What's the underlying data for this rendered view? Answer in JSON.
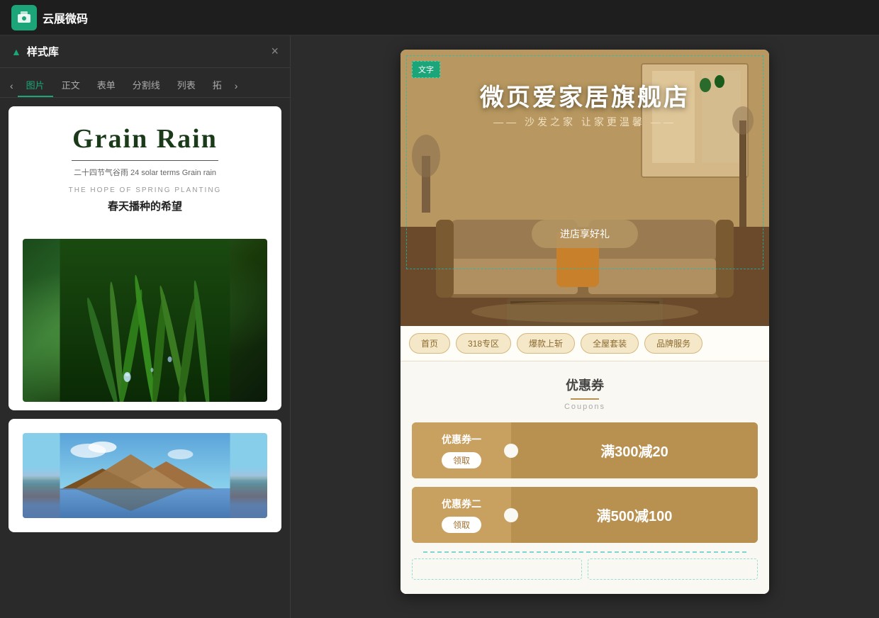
{
  "app": {
    "name": "云展微码",
    "logo_icon": "🖥"
  },
  "panel": {
    "title": "样式库",
    "close_label": "×",
    "tabs": [
      {
        "label": "图片",
        "active": true
      },
      {
        "label": "正文"
      },
      {
        "label": "表单"
      },
      {
        "label": "分割线"
      },
      {
        "label": "列表"
      },
      {
        "label": "拓"
      }
    ],
    "nav_prev": "‹",
    "nav_next": "›"
  },
  "template_card1": {
    "title": "Grain Rain",
    "subtitle": "二十四节气谷雨 24  solar terms Grain rain",
    "en_label": "THE HOPE OF SPRING PLANTING",
    "cn_label": "春天播种的希望",
    "image_alt": "grain rain grass with water drops"
  },
  "template_card2": {
    "image_alt": "mountain landscape"
  },
  "preview": {
    "hero": {
      "text_badge": "文字",
      "main_title": "微页爱家居旗舰店",
      "subtitle": "—— 沙发之家 让家更温馨 ——",
      "cta_label": "进店享好礼"
    },
    "nav_tabs": [
      {
        "label": "首页"
      },
      {
        "label": "318专区"
      },
      {
        "label": "爆款上斩"
      },
      {
        "label": "全屋套装"
      },
      {
        "label": "品牌服务"
      }
    ],
    "coupons": {
      "section_title": "优惠券",
      "section_subtitle": "Coupons",
      "items": [
        {
          "name": "优惠券一",
          "btn_label": "领取",
          "amount": "满300减20"
        },
        {
          "name": "优惠券二",
          "btn_label": "领取",
          "amount": "满500减100"
        }
      ]
    }
  }
}
